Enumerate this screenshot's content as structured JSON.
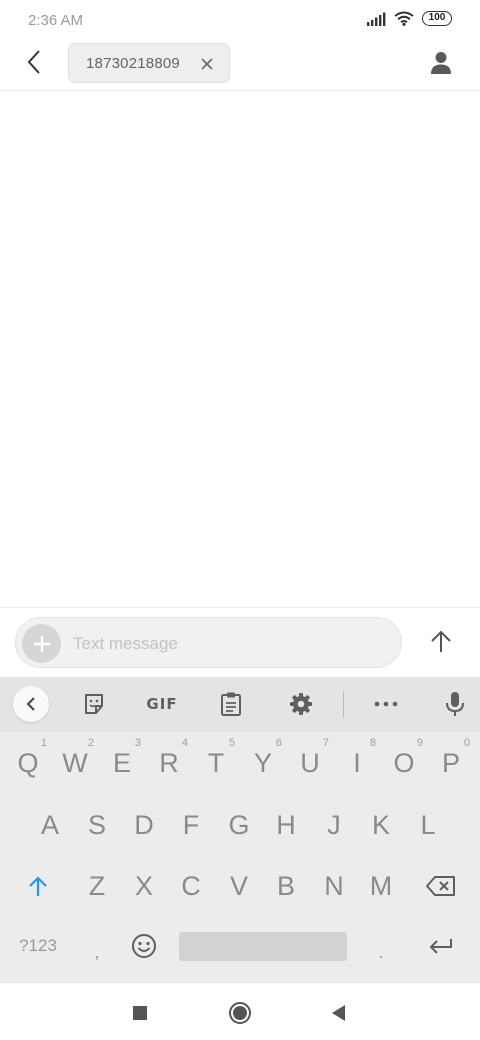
{
  "status_bar": {
    "time": "2:36 AM",
    "battery": "100"
  },
  "header": {
    "recipient": "18730218809"
  },
  "compose": {
    "placeholder": "Text message"
  },
  "keyboard": {
    "toolbar": {
      "gif_label": "GIF"
    },
    "row1": [
      {
        "key": "Q",
        "hint": "1"
      },
      {
        "key": "W",
        "hint": "2"
      },
      {
        "key": "E",
        "hint": "3"
      },
      {
        "key": "R",
        "hint": "4"
      },
      {
        "key": "T",
        "hint": "5"
      },
      {
        "key": "Y",
        "hint": "6"
      },
      {
        "key": "U",
        "hint": "7"
      },
      {
        "key": "I",
        "hint": "8"
      },
      {
        "key": "O",
        "hint": "9"
      },
      {
        "key": "P",
        "hint": "0"
      }
    ],
    "row2": [
      "A",
      "S",
      "D",
      "F",
      "G",
      "H",
      "J",
      "K",
      "L"
    ],
    "row3": [
      "Z",
      "X",
      "C",
      "V",
      "B",
      "N",
      "M"
    ],
    "row4": {
      "symbols": "?123",
      "comma": ",",
      "period": "."
    }
  },
  "icons": {
    "back": "chevron-left-icon",
    "chip_close": "close-icon",
    "contact": "person-icon",
    "add": "plus-icon",
    "send": "arrow-up-icon",
    "sticker": "sticker-icon",
    "clipboard": "clipboard-icon",
    "settings": "gear-icon",
    "more": "more-horizontal-icon",
    "mic": "microphone-icon",
    "shift": "shift-arrow-icon",
    "backspace": "backspace-icon",
    "emoji": "emoji-icon",
    "enter": "enter-icon",
    "nav_recents": "square-icon",
    "nav_home": "circle-icon",
    "nav_back": "triangle-back-icon"
  },
  "colors": {
    "accent": "#2196f3",
    "key_text": "#8a8a8a",
    "keyboard_bg": "#ececec"
  }
}
